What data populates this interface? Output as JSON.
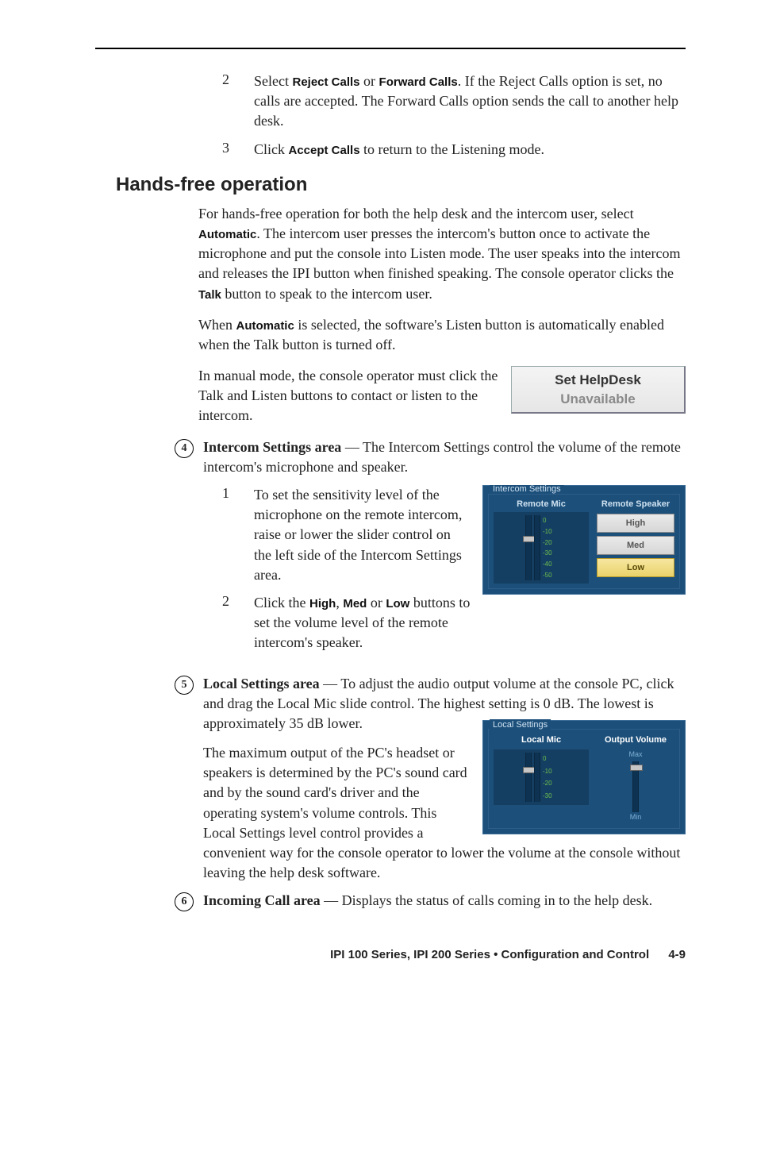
{
  "steps_top": [
    {
      "num": "2",
      "parts": [
        "Select ",
        "Reject Calls",
        " or ",
        "Forward Calls",
        ". If the Reject Calls option is set, no calls are accepted. The Forward Calls option sends the call to another  help desk."
      ]
    },
    {
      "num": "3",
      "parts": [
        "Click ",
        "Accept Calls",
        " to return to the Listening mode."
      ]
    }
  ],
  "section": {
    "title": "Hands-free operation"
  },
  "para1": {
    "pre": "For hands-free operation for both the  help desk and the intercom user, select ",
    "b1": "Automatic",
    "mid": ". The intercom user presses the intercom's button once to activate the microphone and put the console into Listen mode. The user speaks into the intercom and releases the IPI button when finished speaking. The console operator clicks the ",
    "b2": "Talk",
    "end": " button to speak to the intercom user."
  },
  "para2": {
    "pre": "When ",
    "b1": "Automatic",
    "end": " is selected, the software's Listen button is automatically enabled when the Talk button is turned off."
  },
  "para3": "In manual mode, the console operator must click the Talk and Listen buttons to contact or listen to the intercom.",
  "btn": {
    "l1": "Set HelpDesk",
    "l2": "Unavailable"
  },
  "item4": {
    "num": "4",
    "lead": "Intercom Settings area",
    "rest": " —  The Intercom Settings control the volume of the remote intercom's microphone and speaker."
  },
  "sub4": [
    {
      "num": "1",
      "text": "To set the sensitivity level of the microphone on the remote intercom, raise or lower the slider control on the left side of the Intercom Settings area."
    },
    {
      "num": "2",
      "pre": "Click the ",
      "b1": "High",
      "c1": ", ",
      "b2": "Med",
      "c2": " or ",
      "b3": "Low",
      "end": " buttons to set the volume level of the remote intercom's speaker."
    }
  ],
  "intercom_panel": {
    "title": "Intercom Settings",
    "remote_mic": "Remote Mic",
    "remote_spk": "Remote Speaker",
    "ticks": [
      "0",
      "-10",
      "-20",
      "-30",
      "-40",
      "-50"
    ],
    "btns": {
      "high": "High",
      "med": "Med",
      "low": "Low"
    }
  },
  "item5": {
    "num": "5",
    "lead": "Local Settings area",
    "rest": " — To adjust the audio output volume at the console PC, click and drag the Local Mic slide control.  The highest setting is 0 dB.  The lowest is approximately 35 dB lower."
  },
  "para5b": "The maximum output of the PC's headset or speakers is determined by the PC's sound card and by the sound card's driver and the operating system's volume controls.  This Local Settings level control provides a convenient way for the console operator to lower the volume at the console without leaving the  help desk software.",
  "local_panel": {
    "title": "Local Settings",
    "local_mic": "Local Mic",
    "output_vol": "Output Volume",
    "ticks": [
      "0",
      "-10",
      "-20",
      "-30"
    ],
    "max": "Max",
    "min": "Min"
  },
  "item6": {
    "num": "6",
    "lead": "Incoming Call area",
    "rest": " — Displays the status of calls coming in to the help desk."
  },
  "footer": {
    "title": "IPI 100 Series, IPI 200 Series • Configuration and Control",
    "page": "4-9"
  }
}
